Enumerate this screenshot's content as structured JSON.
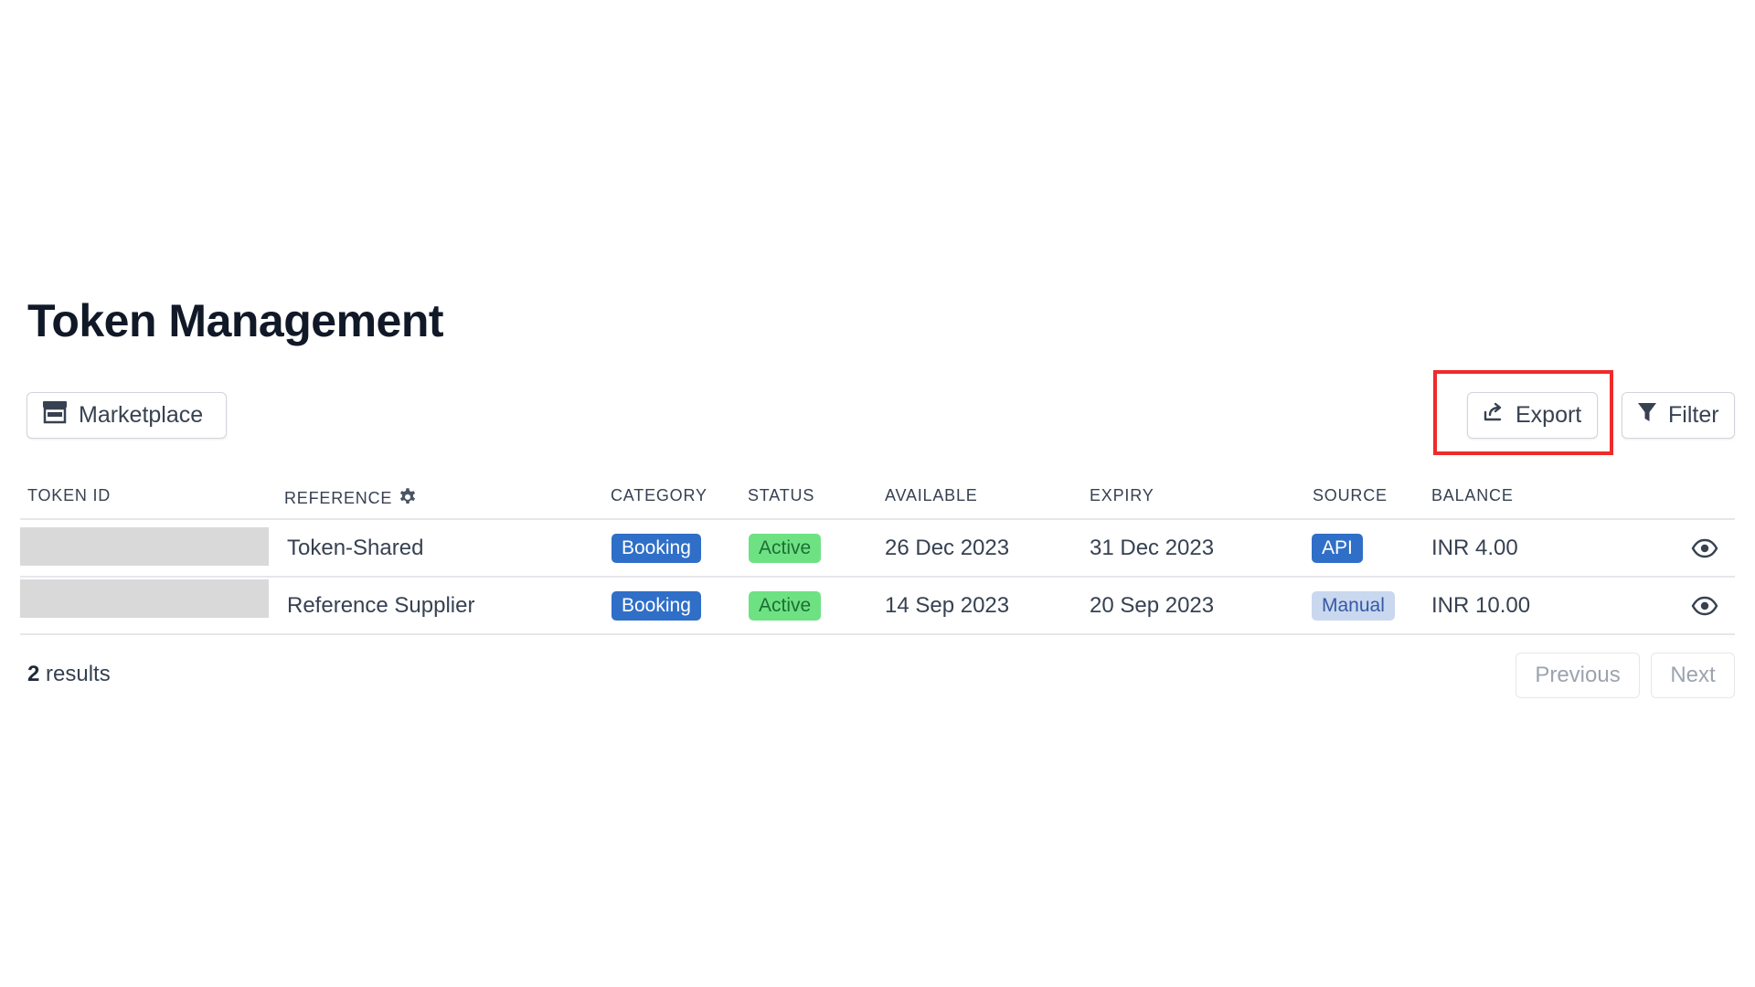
{
  "page": {
    "title": "Token Management"
  },
  "toolbar": {
    "marketplace_label": "Marketplace",
    "export_label": "Export",
    "filter_label": "Filter"
  },
  "table": {
    "columns": [
      "TOKEN ID",
      "REFERENCE",
      "CATEGORY",
      "STATUS",
      "AVAILABLE",
      "EXPIRY",
      "SOURCE",
      "BALANCE"
    ],
    "rows": [
      {
        "token_id": "",
        "reference": "Token-Shared",
        "category": "Booking",
        "status": "Active",
        "available": "26 Dec 2023",
        "expiry": "31 Dec 2023",
        "source": "API",
        "balance": "INR 4.00"
      },
      {
        "token_id": "",
        "reference": "Reference Supplier",
        "category": "Booking",
        "status": "Active",
        "available": "14 Sep 2023",
        "expiry": "20 Sep 2023",
        "source": "Manual",
        "balance": "INR 10.00"
      }
    ]
  },
  "footer": {
    "results_count": "2",
    "results_label": "results",
    "previous_label": "Previous",
    "next_label": "Next"
  },
  "colors": {
    "badge_blue": "#2f6fc8",
    "badge_green": "#6ee283",
    "badge_manual": "#c9d8ee",
    "highlight_red": "#ef2b2b"
  },
  "icons": [
    "store-icon",
    "export-icon",
    "filter-icon",
    "gear-icon",
    "eye-icon"
  ]
}
